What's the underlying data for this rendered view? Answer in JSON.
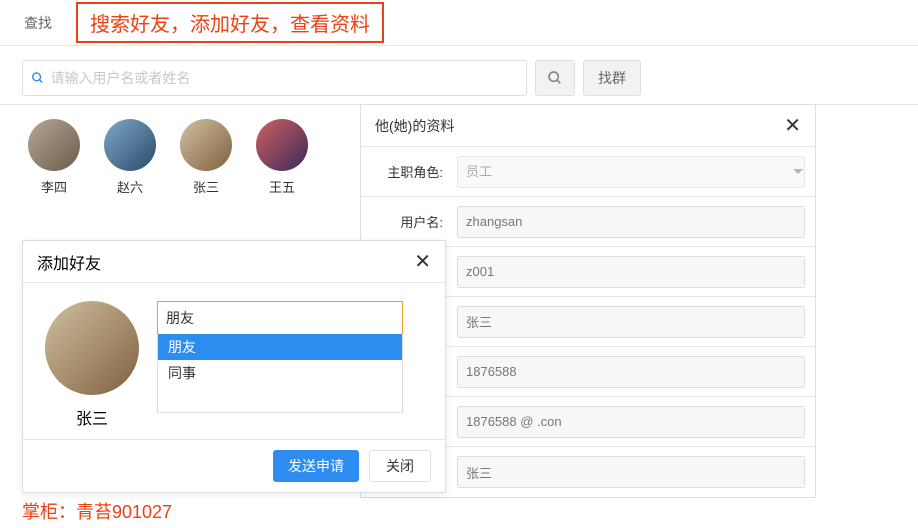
{
  "top": {
    "tab": "查找",
    "annotation": "搜索好友，添加好友，查看资料"
  },
  "search": {
    "placeholder": "请输入用户名或者姓名",
    "find_group": "找群"
  },
  "friends": [
    {
      "name": "李四"
    },
    {
      "name": "赵六"
    },
    {
      "name": "张三"
    },
    {
      "name": "王五"
    }
  ],
  "profile": {
    "title": "他(她)的资料",
    "rows": {
      "role_label": "主职角色:",
      "role_value": "员工",
      "username_label": "用户名:",
      "username_value": "zhangsan",
      "code_value": "z001",
      "name_value": "张三",
      "phone_value": "1876588",
      "email_value": "1876588      @    .con",
      "nick_value": "张三"
    }
  },
  "add": {
    "title": "添加好友",
    "target_name": "张三",
    "combo_value": "朋友",
    "options": [
      "朋友",
      "同事"
    ],
    "submit": "发送申请",
    "close": "关闭"
  },
  "watermark": "掌柜：青苔901027"
}
